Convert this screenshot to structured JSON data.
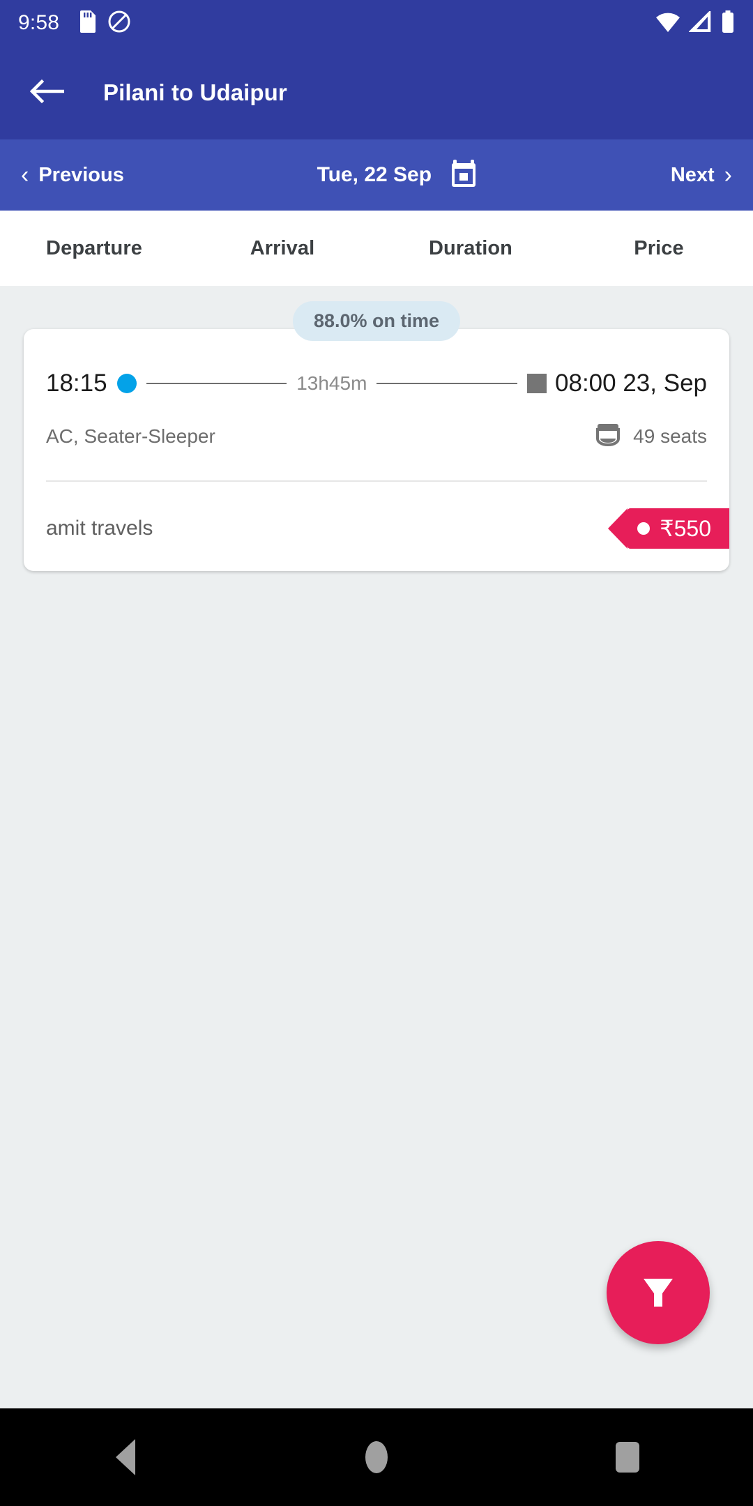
{
  "status_bar": {
    "time": "9:58",
    "left_icons": [
      "sd-card-icon",
      "do-not-disturb-icon"
    ],
    "right_icons": [
      "wifi-icon",
      "cellular-signal-icon",
      "battery-icon"
    ]
  },
  "toolbar": {
    "back_icon": "back-arrow-icon",
    "title": "Pilani to Udaipur",
    "background": "#303C9F"
  },
  "date_bar": {
    "previous_label": "Previous",
    "previous_chevron": "‹",
    "date_label": "Tue, 22 Sep",
    "calendar_icon": "calendar-icon",
    "next_label": "Next",
    "next_chevron": "›",
    "background": "#3F51B5"
  },
  "sort_tabs": [
    {
      "label": "Departure"
    },
    {
      "label": "Arrival"
    },
    {
      "label": "Duration"
    },
    {
      "label": "Price"
    }
  ],
  "results": [
    {
      "on_time_badge": "88.0% on time",
      "departure_time": "18:15",
      "duration": "13h45m",
      "arrival_time": "08:00 23, Sep",
      "bus_type": "AC, Seater-Sleeper",
      "seats_icon": "seat-icon",
      "seats": "49 seats",
      "operator": "amit travels",
      "price": "₹550",
      "price_tag_color": "#E71E59",
      "departure_dot_color": "#03A2E8",
      "arrival_marker_color": "#757575",
      "badge_color": "#DAEAF3"
    }
  ],
  "fab": {
    "icon": "filter-funnel-icon",
    "color": "#E71E59"
  },
  "nav_bar": {
    "back": "nav-back-icon",
    "home": "nav-home-icon",
    "recents": "nav-recents-icon"
  }
}
